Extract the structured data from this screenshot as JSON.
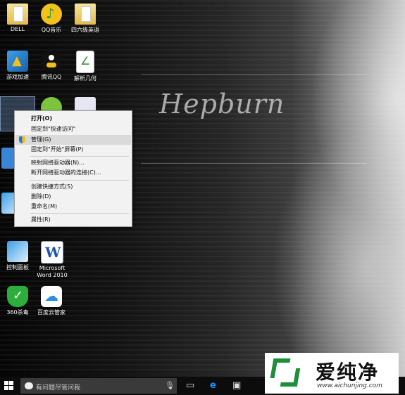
{
  "wallpaper": {
    "watermark": "Hepburn"
  },
  "desktop_icons": [
    {
      "label": "DELL",
      "icon": "folder-icon"
    },
    {
      "label": "QQ音乐",
      "icon": "qq-music-icon"
    },
    {
      "label": "四六级英语",
      "icon": "folder-icon"
    },
    {
      "label": "游戏加速",
      "icon": "game-accelerator-icon"
    },
    {
      "label": "腾讯QQ",
      "icon": "qq-penguin-icon"
    },
    {
      "label": "解析几何",
      "icon": "document-icon"
    },
    {
      "label": "控制面板",
      "icon": "control-panel-icon"
    },
    {
      "label": "Microsoft Word 2010",
      "icon": "word-icon"
    },
    {
      "label": "360杀毒",
      "icon": "360-antivirus-icon"
    },
    {
      "label": "百度云管家",
      "icon": "baidu-cloud-icon"
    }
  ],
  "context_menu": {
    "items": [
      {
        "label": "打开(O)",
        "bold": true
      },
      {
        "label": "固定到\"快速访问\""
      },
      {
        "label": "管理(G)",
        "icon": "admin-shield-icon",
        "highlighted": true
      },
      {
        "label": "固定到\"开始\"屏幕(P)"
      },
      {
        "label": "映射网络驱动器(N)..."
      },
      {
        "label": "断开网络驱动器的连接(C)..."
      },
      {
        "label": "创建快捷方式(S)"
      },
      {
        "label": "删除(D)"
      },
      {
        "label": "重命名(M)"
      },
      {
        "label": "属性(R)"
      }
    ]
  },
  "taskbar": {
    "search_placeholder": "有问题尽管问我",
    "icons": [
      "windows-start-icon",
      "cortana-icon",
      "microphone-icon",
      "task-view-icon",
      "edge-icon",
      "store-icon"
    ]
  },
  "brand": {
    "name": "爱纯净",
    "url": "www.aichunjing.com"
  }
}
